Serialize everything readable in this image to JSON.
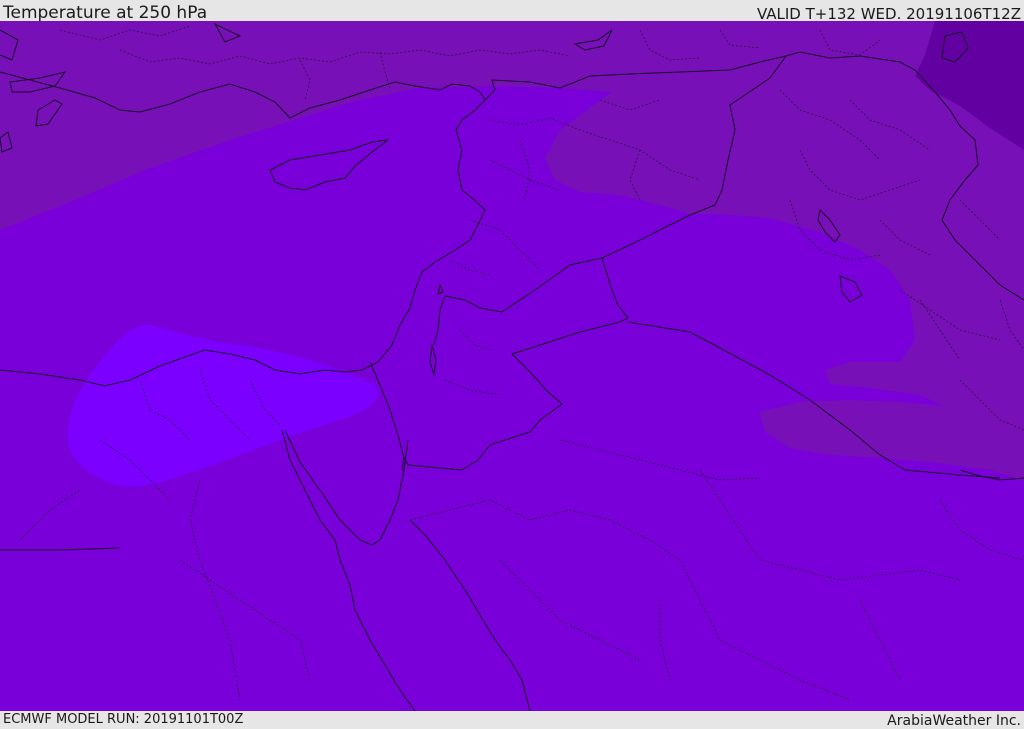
{
  "header": {
    "title": "Temperature at 250 hPa",
    "valid": "VALID T+132 WED. 20191106T12Z"
  },
  "footer": {
    "model_run": "ECMWF MODEL RUN: 20191101T00Z",
    "credit": "ArabiaWeather Inc."
  },
  "map": {
    "colors": {
      "base": "#7a00d9",
      "cool_band": "#7810b8",
      "cold_corner": "#6200a2",
      "warm_blob": "#7b00ff",
      "coast": "#1a0a2a"
    }
  }
}
